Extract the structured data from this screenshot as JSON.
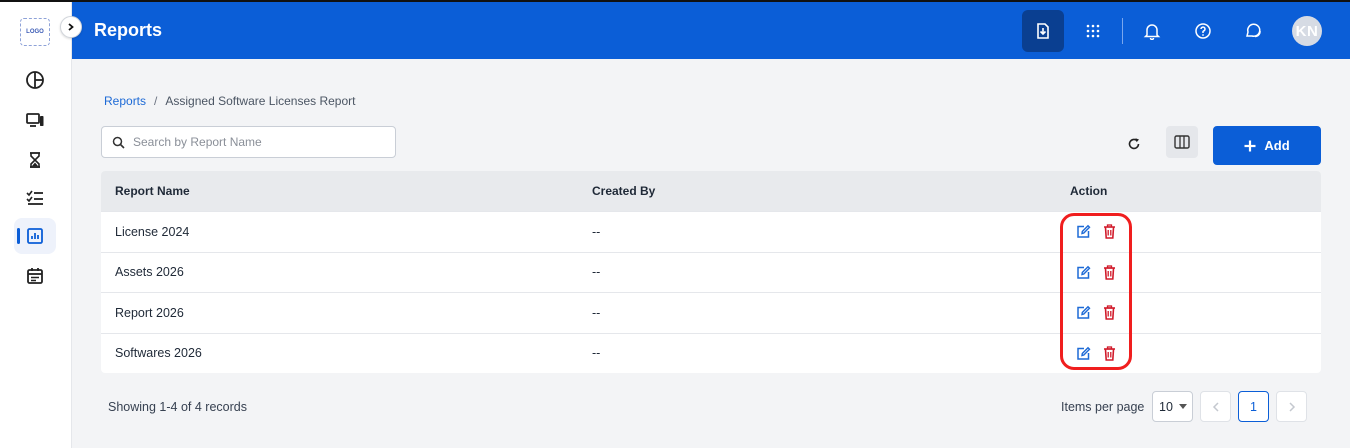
{
  "app": {
    "logo_text": "LOGO",
    "page_title": "Reports",
    "avatar_initials": "KN",
    "accent_color": "#0b5ed7"
  },
  "sidebar": {
    "items": [
      {
        "name": "dashboard-icon"
      },
      {
        "name": "devices-icon"
      },
      {
        "name": "hourglass-icon"
      },
      {
        "name": "checklist-icon"
      },
      {
        "name": "reports-icon",
        "active": true
      },
      {
        "name": "calendar-icon"
      }
    ]
  },
  "header": {
    "icons": [
      "download-icon",
      "apps-grid-icon",
      "bell-icon",
      "help-icon",
      "chat-icon"
    ]
  },
  "breadcrumb": {
    "parent": "Reports",
    "separator": "/",
    "current": "Assigned Software Licenses Report"
  },
  "search": {
    "placeholder": "Search by Report Name",
    "value": ""
  },
  "toolbar": {
    "add_label": "Add"
  },
  "table": {
    "headers": [
      "Report Name",
      "Created By",
      "Action"
    ],
    "rows": [
      {
        "name": "License 2024",
        "created_by": "--"
      },
      {
        "name": "Assets 2026",
        "created_by": "--"
      },
      {
        "name": "Report 2026",
        "created_by": "--"
      },
      {
        "name": "Softwares 2026",
        "created_by": "--"
      }
    ]
  },
  "footer": {
    "records_text": "Showing 1-4 of 4 records",
    "items_per_page_label": "Items per page",
    "items_per_page_value": "10",
    "current_page": "1"
  }
}
